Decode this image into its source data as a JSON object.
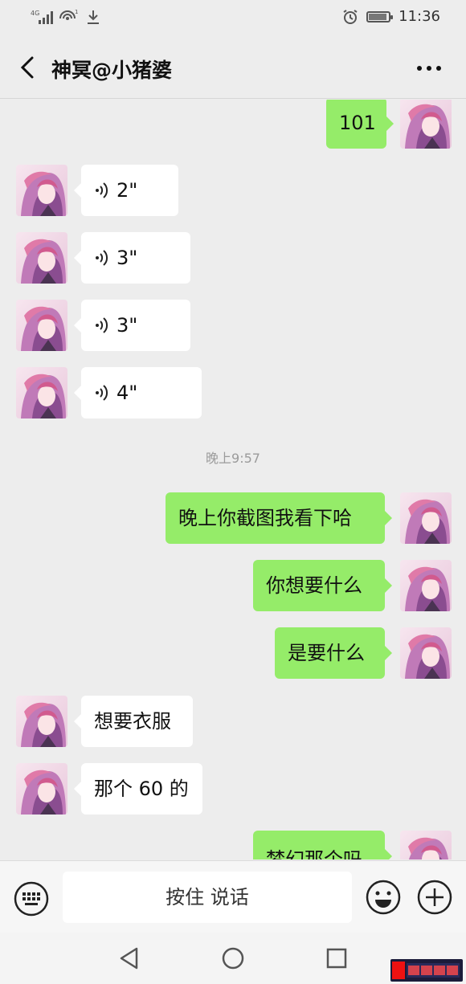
{
  "status_bar": {
    "network": "4G",
    "time": "11:36"
  },
  "header": {
    "title": "神冥@小猪婆"
  },
  "messages": {
    "m0": {
      "text": "101"
    },
    "m1": {
      "duration": "2\""
    },
    "m2": {
      "duration": "3\""
    },
    "m3": {
      "duration": "3\""
    },
    "m4": {
      "duration": "4\""
    },
    "timestamp": "晚上9:57",
    "m5": {
      "text": "晚上你截图我看下哈"
    },
    "m6": {
      "text": "你想要什么"
    },
    "m7": {
      "text": "是要什么"
    },
    "m8": {
      "text": "想要衣服"
    },
    "m9": {
      "text": "那个 60 的"
    },
    "m10": {
      "text": "梦幻那个吗"
    }
  },
  "input_bar": {
    "hold_to_talk": "按住 说话"
  },
  "colors": {
    "sent_bubble": "#95ec69",
    "received_bubble": "#ffffff",
    "background": "#ededed"
  },
  "icons": [
    "back-icon",
    "more-icon",
    "voice-wave-icon",
    "keyboard-icon",
    "emoji-icon",
    "plus-icon",
    "nav-back-icon",
    "nav-home-icon",
    "nav-recent-icon"
  ]
}
